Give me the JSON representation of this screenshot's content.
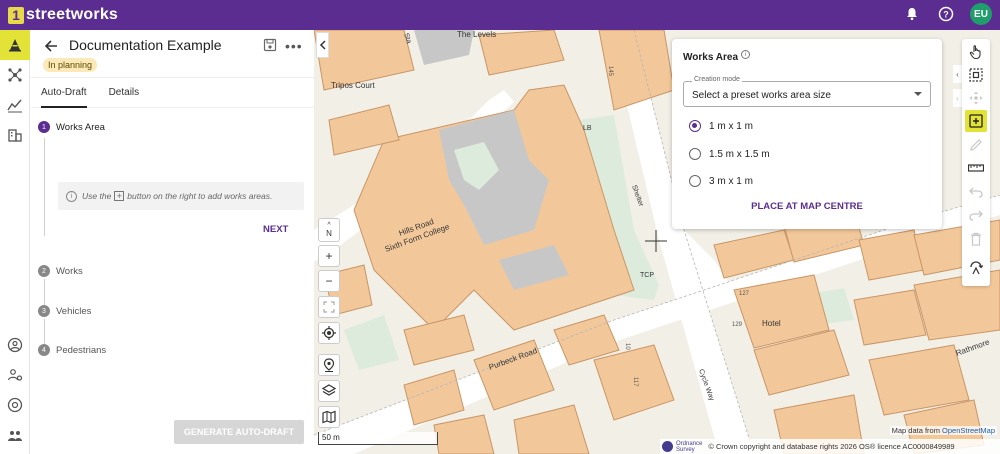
{
  "app": {
    "logo_mark": "1",
    "logo_text": "streetworks",
    "avatar_initials": "EU",
    "brand_color": "#5b2d91",
    "accent_color": "#e3e236"
  },
  "topbar_icons": [
    "bell-icon",
    "help-icon"
  ],
  "rail": {
    "items": [
      "cone-icon",
      "network-icon",
      "analytics-icon",
      "buildings-icon"
    ],
    "bottom_items": [
      "user-icon",
      "people-settings-icon",
      "support-icon",
      "team-icon"
    ]
  },
  "panel": {
    "title": "Documentation Example",
    "status": "In planning",
    "tabs": [
      {
        "label": "Auto-Draft",
        "active": true
      },
      {
        "label": "Details",
        "active": false
      }
    ],
    "steps": [
      {
        "num": "1",
        "label": "Works Area",
        "active": true
      },
      {
        "num": "2",
        "label": "Works",
        "active": false
      },
      {
        "num": "3",
        "label": "Vehicles",
        "active": false
      },
      {
        "num": "4",
        "label": "Pedestrians",
        "active": false
      }
    ],
    "hint_before": "Use the",
    "hint_after": "button on the right to add works areas.",
    "next_label": "NEXT",
    "generate_label": "GENERATE AUTO-DRAFT"
  },
  "works_area": {
    "title": "Works Area",
    "select_label": "Creation mode",
    "select_value": "Select a preset works area size",
    "options": [
      {
        "label": "1 m x 1 m",
        "checked": true
      },
      {
        "label": "1.5 m x 1.5 m",
        "checked": false
      },
      {
        "label": "3 m x 1 m",
        "checked": false
      }
    ],
    "place_label": "PLACE AT MAP CENTRE"
  },
  "map": {
    "labels": {
      "the_levels": "The Levels",
      "tripos_court": "Tripos Court",
      "hills_road": "Hills Road",
      "sixth_form": "Sixth Form College",
      "purbeck_road": "Purbeck Road",
      "hotel": "Hotel",
      "rathmore": "Rathmore",
      "cycle_way": "Cycle Way",
      "shelter": "Shelter",
      "lb": "LB",
      "tcp": "TCP",
      "sta": "Sta",
      "n145": "145",
      "n10": "10",
      "n117": "117",
      "n127": "127",
      "n129": "129"
    },
    "compass": "N",
    "scale_label": "50 m",
    "attribution_prefix": "Map data from",
    "attribution_link": "OpenStreetMap",
    "os_logo_text_1": "Ordnance",
    "os_logo_text_2": "Survey",
    "copyright": "© Crown copyright and database rights 2026 OS® licence AC0000849989"
  }
}
